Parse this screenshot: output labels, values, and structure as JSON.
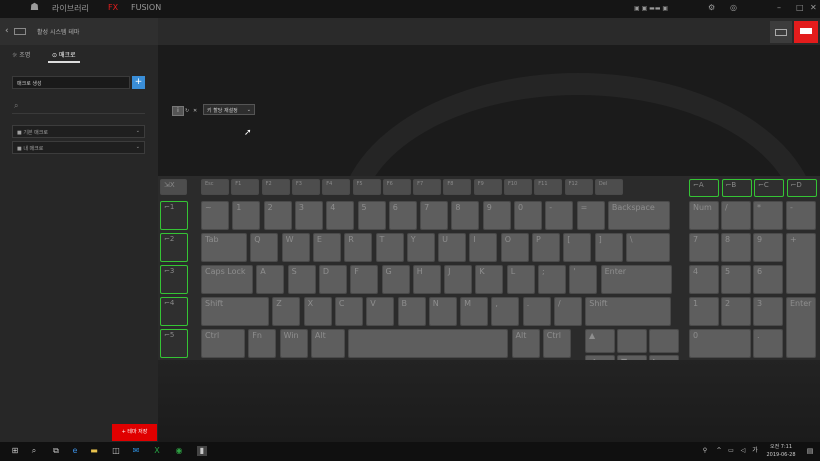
{
  "topbar": {
    "logo": "alienware-logo",
    "nav": [
      "라이브러리",
      "FX",
      "FUSION"
    ],
    "right_text": "alienware-user",
    "accent": "#e31c1c"
  },
  "sidebar": {
    "back_title": "활성 시스템 테마",
    "tabs": [
      "조명",
      "매크로"
    ],
    "macro_input_placeholder": "매크로 생성",
    "add_label": "+",
    "groups": [
      "기본 매크로",
      "내 매크로"
    ]
  },
  "toolbar": {
    "mini_buttons": [
      "i",
      "↻",
      "✕"
    ],
    "popup_label": "키 할당 재설정"
  },
  "keyboard": {
    "macro_keys": [
      "M1",
      "M2",
      "M3",
      "M4",
      "M5"
    ],
    "fn_row": [
      "Esc",
      "F1",
      "F2",
      "F3",
      "F4",
      "F5",
      "F6",
      "F7",
      "F8",
      "F9",
      "F10",
      "F11",
      "F12",
      "Del"
    ],
    "numpad_macro": [
      "A",
      "B",
      "C",
      "D"
    ],
    "row1": [
      "~",
      "1",
      "2",
      "3",
      "4",
      "5",
      "6",
      "7",
      "8",
      "9",
      "0",
      "-",
      "=",
      "Backspace"
    ],
    "row2": [
      "Tab",
      "Q",
      "W",
      "E",
      "R",
      "T",
      "Y",
      "U",
      "I",
      "O",
      "P",
      "[",
      "]",
      "\\"
    ],
    "row3": [
      "Caps Lock",
      "A",
      "S",
      "D",
      "F",
      "G",
      "H",
      "J",
      "K",
      "L",
      ";",
      "'",
      "Enter"
    ],
    "row4": [
      "Shift",
      "Z",
      "X",
      "C",
      "V",
      "B",
      "N",
      "M",
      ",",
      ".",
      "/",
      "Shift"
    ],
    "row5": [
      "Ctrl",
      "Fn",
      "Win",
      "Alt",
      "",
      "Alt",
      "Ctrl"
    ],
    "numpad": [
      "Num",
      "/",
      "*",
      "-",
      "7",
      "8",
      "9",
      "+",
      "4",
      "5",
      "6",
      "1",
      "2",
      "3",
      "Enter",
      "0",
      "."
    ]
  },
  "save_button": "+ 테마 저장",
  "taskbar": {
    "time": "오전 7:11",
    "date": "2019-06-28"
  }
}
